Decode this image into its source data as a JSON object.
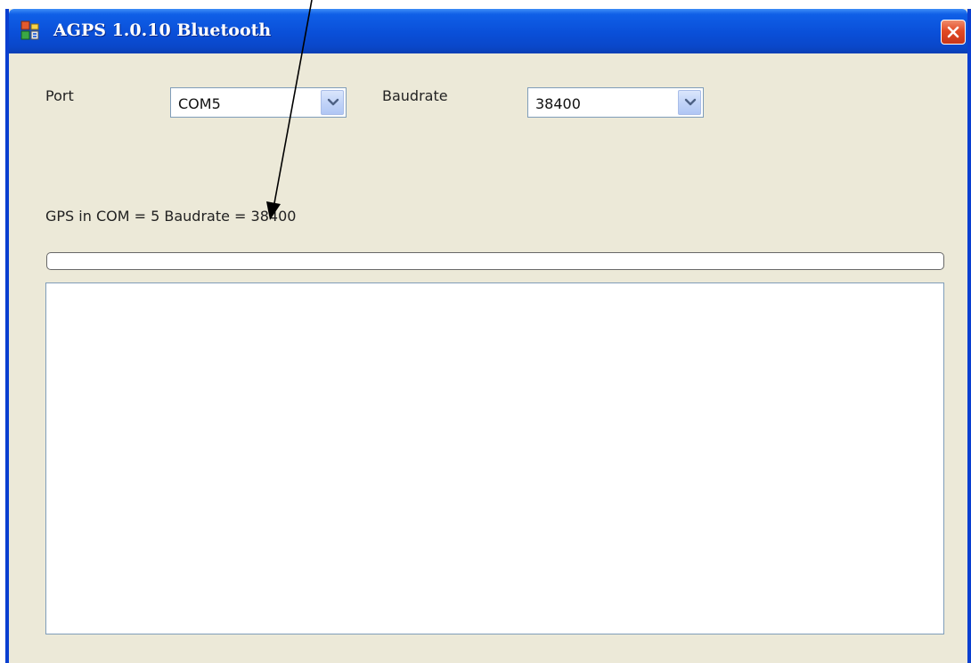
{
  "window": {
    "title": "AGPS 1.0.10  Bluetooth",
    "app_icon": "app-icon",
    "close_icon": "close-icon",
    "close_color": "#e24a24",
    "titlebar_color": "#0a4fd8"
  },
  "settings": {
    "port_label": "Port",
    "port_value": "COM5",
    "baudrate_label": "Baudrate",
    "baudrate_value": "38400",
    "dropdown_icon": "chevron-down-icon"
  },
  "status": {
    "text": "GPS in COM = 5 Baudrate = 38400"
  },
  "progress": {
    "value_percent": 0
  },
  "log": {
    "content": ""
  },
  "annotation": {
    "type": "arrow",
    "color": "#000000"
  }
}
